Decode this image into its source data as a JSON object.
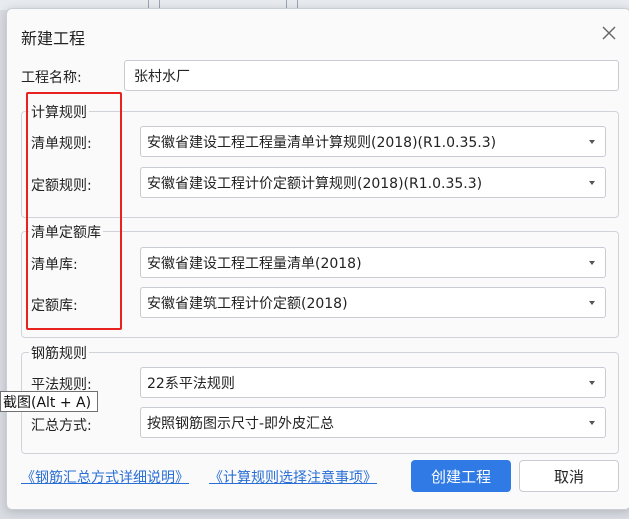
{
  "dialog": {
    "title": "新建工程",
    "project_name_label": "工程名称:",
    "project_name_value": "张村水厂"
  },
  "calc_rules": {
    "title": "计算规则",
    "list_rule_label": "清单规则:",
    "list_rule_value": "安徽省建设工程工程量清单计算规则(2018)(R1.0.35.3)",
    "quota_rule_label": "定额规则:",
    "quota_rule_value": "安徽省建设工程计价定额计算规则(2018)(R1.0.35.3)"
  },
  "list_quota_lib": {
    "title": "清单定额库",
    "list_lib_label": "清单库:",
    "list_lib_value": "安徽省建设工程工程量清单(2018)",
    "quota_lib_label": "定额库:",
    "quota_lib_value": "安徽省建筑工程计价定额(2018)"
  },
  "rebar_rules": {
    "title": "钢筋规则",
    "flat_rule_label": "平法规则:",
    "flat_rule_value": "22系平法规则",
    "summary_label": "汇总方式:",
    "summary_value": "按照钢筋图示尺寸-即外皮汇总"
  },
  "tooltip": "截图(Alt + A)",
  "links": {
    "rebar_summary_help": "《钢筋汇总方式详细说明》",
    "calc_rule_notes": "《计算规则选择注意事项》"
  },
  "buttons": {
    "create": "创建工程",
    "cancel": "取消"
  },
  "colors": {
    "primary": "#2f7ae5",
    "link": "#2a6fd6",
    "highlight": "#e8221f"
  }
}
